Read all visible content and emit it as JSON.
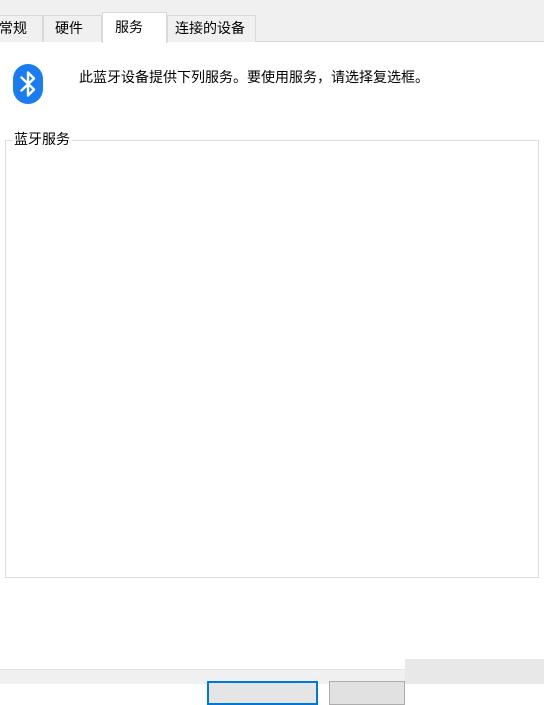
{
  "tabs": [
    {
      "label": "常规",
      "active": false
    },
    {
      "label": "硬件",
      "active": false
    },
    {
      "label": "服务",
      "active": true
    },
    {
      "label": "连接的设备",
      "active": false
    }
  ],
  "header": {
    "icon": "bluetooth-icon",
    "description": "此蓝牙设备提供下列服务。要使用服务，请选择复选框。"
  },
  "services_group": {
    "legend": "蓝牙服务",
    "items": []
  },
  "colors": {
    "bluetooth_blue": "#1a7cf0",
    "focus_blue": "#0078d7"
  }
}
